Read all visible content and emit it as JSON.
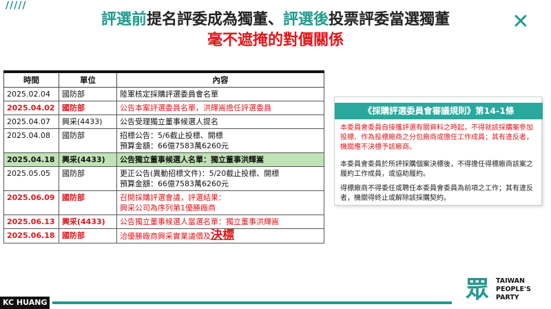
{
  "header": {
    "stripes": "/////",
    "title1_part1": "評選前",
    "title1_part2": "提名評委成為獨董、",
    "title1_part3": "評選後",
    "title1_part4": "投票評委當選獨董",
    "title2": "毫不遮掩的對價關係",
    "close_icon": "close-icon"
  },
  "table": {
    "headers": [
      "時間",
      "單位",
      "內容"
    ],
    "rows": [
      {
        "date": "2025.02.04",
        "unit": "國防部",
        "desc": [
          "陸軍核定採購評選委員會名單"
        ],
        "style": "normal"
      },
      {
        "date": "2025.04.02",
        "unit": "國防部",
        "desc": [
          "公告本案評選委員名單，洪輝嵩擔任評選委員"
        ],
        "style": "red"
      },
      {
        "date": "2025.04.07",
        "unit": "興采(4433)",
        "desc": [
          "公告受理獨立董事候選人提名"
        ],
        "style": "normal"
      },
      {
        "date": "2025.04.08",
        "unit": "國防部",
        "desc": [
          "招標公告：5/6截止投標、開標",
          "預算金額：66億7583萬6260元"
        ],
        "style": "normal"
      },
      {
        "date": "2025.04.18",
        "unit": "興采(4433)",
        "desc": [
          "公告獨立董事候選人名單：獨立董事洪輝嵩"
        ],
        "style": "green"
      },
      {
        "date": "2025.05.05",
        "unit": "國防部",
        "desc": [
          "更正公告(異動招標文件)：5/20截止投標、開標",
          "預算金額：66億7583萬6260元"
        ],
        "style": "normal"
      },
      {
        "date": "2025.06.09",
        "unit": "國防部",
        "desc": [
          "召開採購評選會議，評選結果：",
          "興采公司為序列第1優勝廠商"
        ],
        "style": "red"
      },
      {
        "date": "2025.06.13",
        "unit": "興采(4433)",
        "desc": [
          "公告獨立董事候選人當選名單：獨立董事洪輝嵩"
        ],
        "style": "red"
      },
      {
        "date": "2025.06.18",
        "unit": "國防部",
        "desc": [
          "洽優勝廠商興采實業議價及"
        ],
        "desc_big": "決標",
        "style": "red"
      }
    ]
  },
  "rules": {
    "title": "《採購評選委員會審議規則》第14-1條",
    "p1": "本委員會委員自接獲評選有關資料之時起，不得就該採購案參加投標、作為投標廠商之分包廠商或擔任工作成員；其有違反者，機關應不決標予該廠商。",
    "p2": "本委員會委員於所評採購個案決標後，不得擔任得標廠商該案之履約工作成員，或協助履約。",
    "p3": "得標廠商不得委任或聘任本委員會委員為前項之工作；其有違反者，機關得終止或解除該採購契約。"
  },
  "footer": {
    "name": "KC HUANG",
    "logo_icon": "party-logo-icon",
    "logo_line1": "TAIWAN",
    "logo_line2": "PEOPLE'S",
    "logo_line3": "PARTY"
  },
  "colors": {
    "accent": "#1f9a8f",
    "red": "#e0161b",
    "highlight_row": "#bfe3b4"
  }
}
